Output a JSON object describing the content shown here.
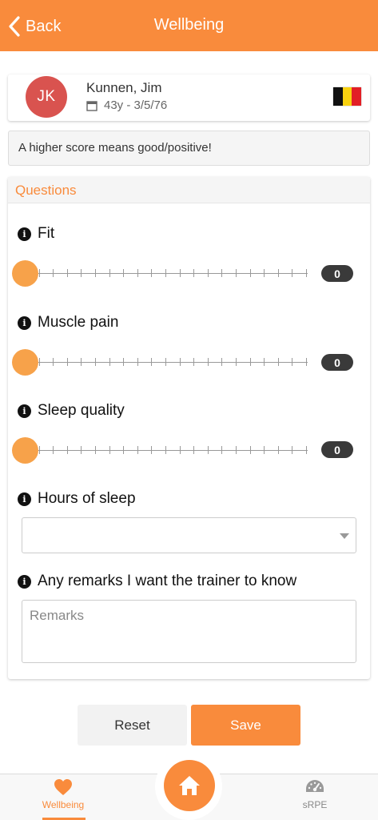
{
  "header": {
    "back_label": "Back",
    "title": "Wellbeing"
  },
  "profile": {
    "initials": "JK",
    "name": "Kunnen, Jim",
    "meta": "43y - 3/5/76",
    "flag": "belgium-flag",
    "avatar_color": "#d9534f"
  },
  "info_text": "A higher score means good/positive!",
  "questions": {
    "header": "Questions",
    "items": [
      {
        "label": "Fit",
        "value": "0"
      },
      {
        "label": "Muscle pain",
        "value": "0"
      },
      {
        "label": "Sleep quality",
        "value": "0"
      }
    ],
    "hours_of_sleep": {
      "label": "Hours of sleep",
      "value": ""
    },
    "remarks": {
      "label": "Any remarks I want the trainer to know",
      "placeholder": "Remarks"
    }
  },
  "buttons": {
    "reset": "Reset",
    "save": "Save"
  },
  "nav": {
    "wellbeing": "Wellbeing",
    "home": "home-icon",
    "srpe": "sRPE"
  },
  "colors": {
    "accent": "#f98b3c",
    "slider_thumb": "#f7a24a",
    "badge": "#3a3a3a"
  }
}
